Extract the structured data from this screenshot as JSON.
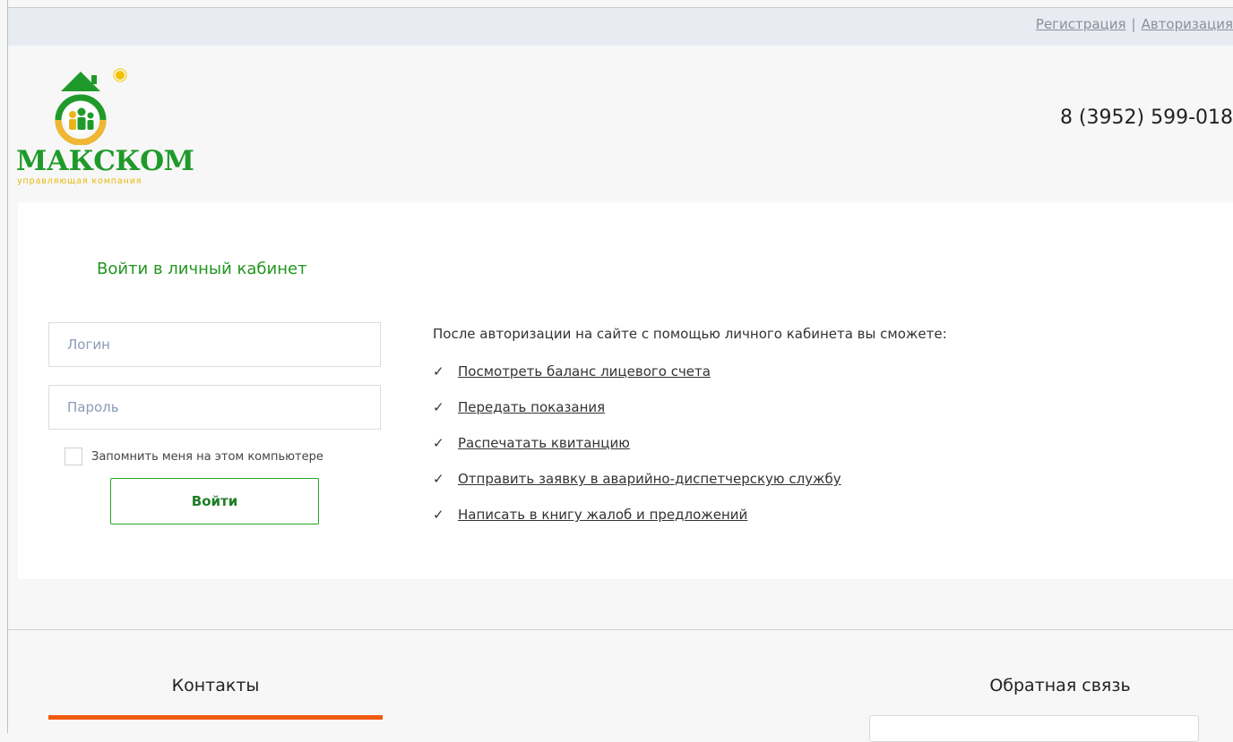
{
  "header": {
    "register_link": "Регистрация",
    "separator": "|",
    "login_link": "Авторизация",
    "phone": "8 (3952) 599-018"
  },
  "logo": {
    "brand": "МАКСКОМ",
    "tagline": "управляющая компания",
    "colors": {
      "green": "#1f9a2a",
      "yellow": "#f0c419",
      "orange": "#f2b632"
    }
  },
  "login": {
    "title": "Войти в личный кабинет",
    "login_placeholder": "Логин",
    "password_placeholder": "Пароль",
    "remember_label": "Запомнить меня на этом компьютере",
    "submit_label": "Войти"
  },
  "info": {
    "intro": "После авторизации на сайте с помощью личного кабинета вы сможете:",
    "check_glyph": "✓",
    "features": [
      "Посмотреть баланс лицевого счета",
      "Передать показания",
      "Распечатать квитанцию",
      "Отправить заявку в аварийно-диспетчерскую службу",
      "Написать в книгу жалоб и предложений"
    ]
  },
  "footer": {
    "contacts_title": "Контакты",
    "feedback_title": "Обратная связь",
    "accent_color": "#f05a0e"
  }
}
